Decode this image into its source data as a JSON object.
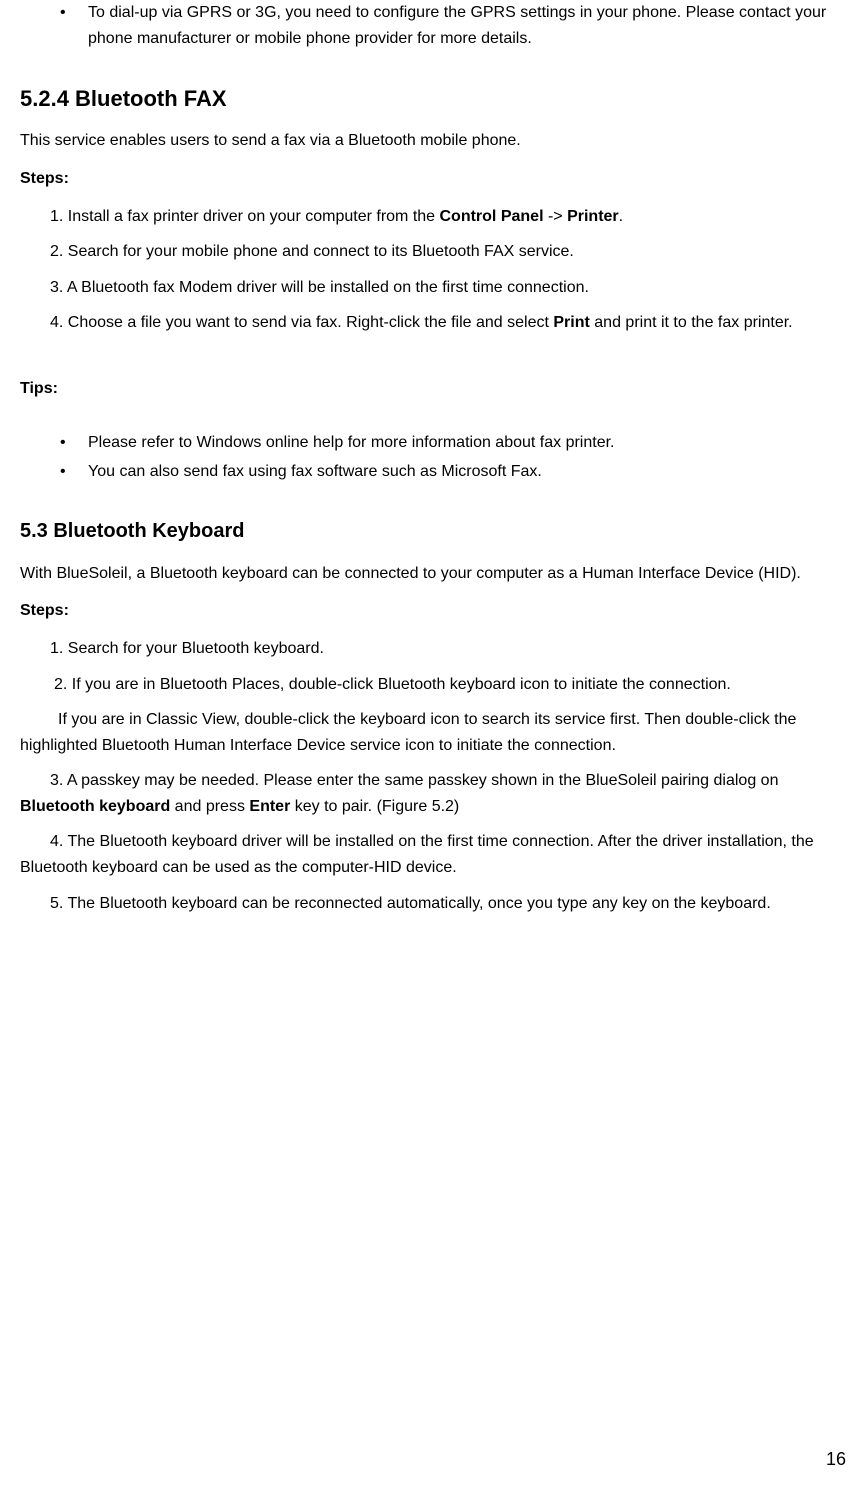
{
  "topBullet": {
    "text": "To dial-up via GPRS or 3G, you need to configure the GPRS settings in your phone. Please contact your phone manufacturer or mobile phone provider for more details."
  },
  "section524": {
    "heading": "5.2.4    Bluetooth FAX",
    "intro": "This service enables users to send a fax via a Bluetooth mobile phone.",
    "stepsLabel": "Steps:",
    "steps": [
      {
        "prefix": "1. Install a fax printer driver on your computer from the ",
        "bold1": "Control Panel",
        "mid1": " -> ",
        "bold2": "Printer",
        "suffix": "."
      },
      {
        "text": "2. Search for your mobile phone and connect to its Bluetooth FAX service."
      },
      {
        "text": "3. A Bluetooth fax Modem driver will be installed on the first time connection."
      },
      {
        "prefix": "4. Choose a file you want to send via fax. Right-click the file and select ",
        "bold1": "Print",
        "suffix": " and print it to the fax printer."
      }
    ],
    "tipsLabel": "Tips:",
    "tips": [
      "Please refer to Windows online help for more information about fax printer.",
      "You can also send fax using fax software such as Microsoft Fax."
    ]
  },
  "section53": {
    "heading": "5.3   Bluetooth Keyboard",
    "intro": "With BlueSoleil, a Bluetooth keyboard can be connected to your computer as a Human Interface Device (HID).",
    "stepsLabel": "Steps:",
    "step1": "1.   Search for your Bluetooth keyboard.",
    "step2": "2. If you are in Bluetooth Places, double-click Bluetooth keyboard icon to initiate the connection.",
    "step2b": "If you are in Classic View, double-click the keyboard icon to search its service first. Then double-click the highlighted Bluetooth Human Interface Device service icon to initiate the connection.",
    "step3_prefix": "3.   A passkey may be needed. Please enter the same passkey shown in the BlueSoleil pairing dialog on ",
    "step3_bold1": "Bluetooth keyboard",
    "step3_mid": " and press ",
    "step3_bold2": "Enter",
    "step3_suffix": " key to pair. (Figure 5.2)",
    "step4": "4.   The Bluetooth keyboard driver will be installed on the first time connection. After the driver installation, the Bluetooth keyboard can be used as the computer-HID device.",
    "step5": "5.   The Bluetooth keyboard can be reconnected automatically, once you type any key on the keyboard."
  },
  "pageNumber": "16"
}
